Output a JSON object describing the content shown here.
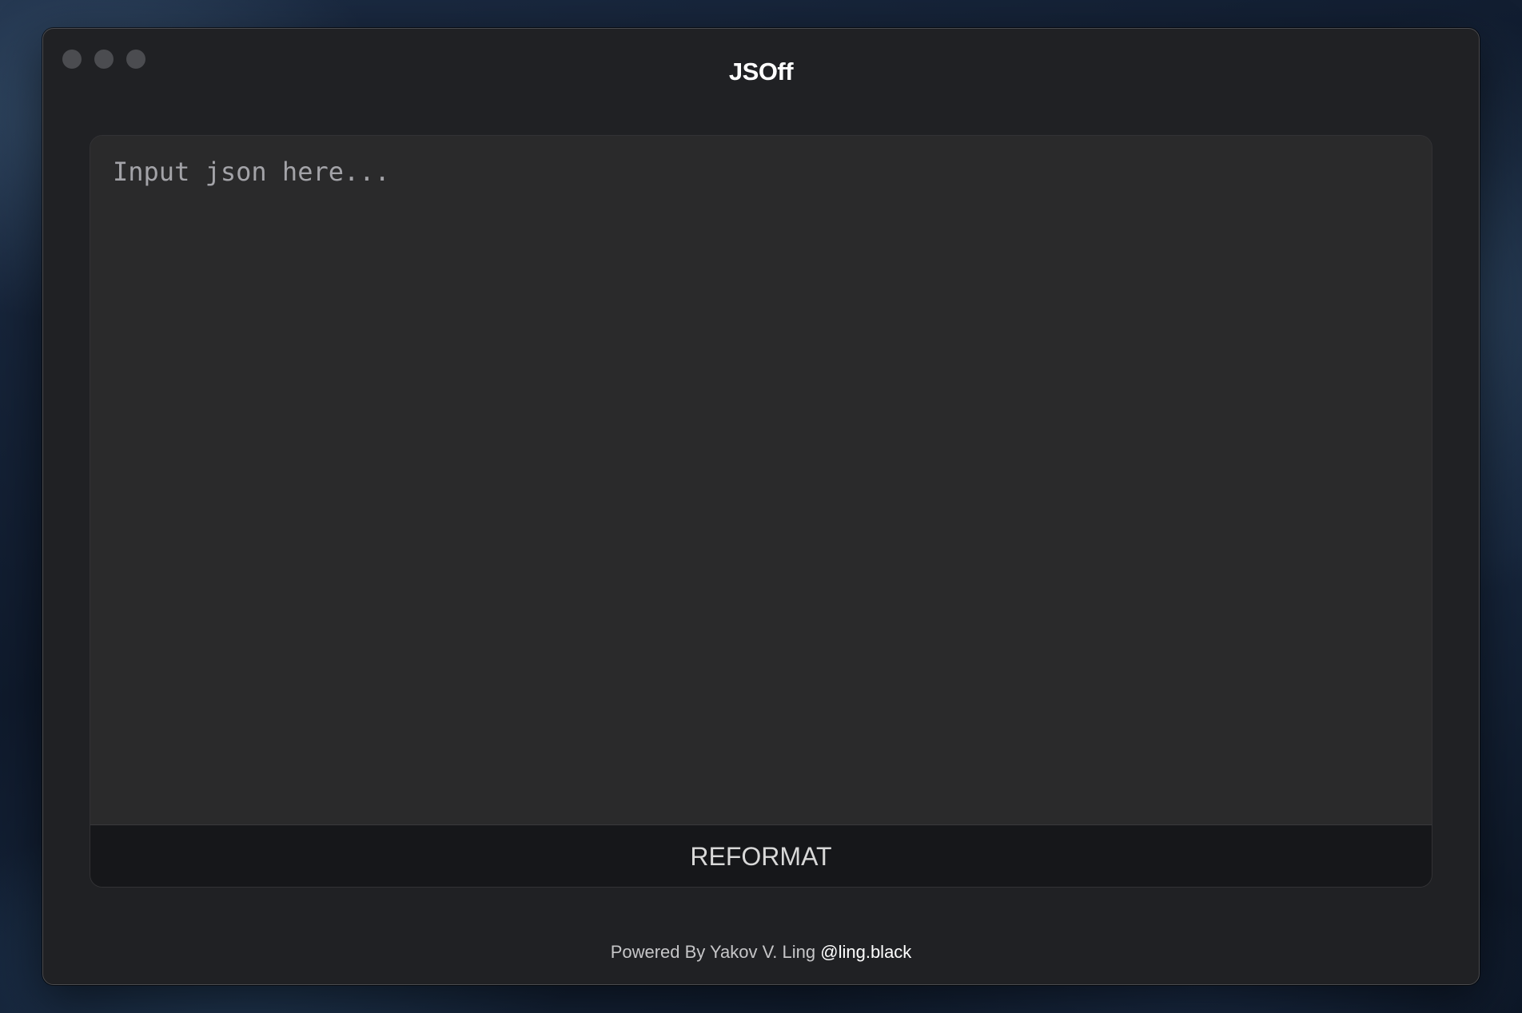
{
  "window": {
    "title": "JSOff"
  },
  "editor": {
    "value": "",
    "placeholder": "Input json here..."
  },
  "actions": {
    "reformat_label": "REFORMAT"
  },
  "footer": {
    "text": "Powered By Yakov V. Ling",
    "link_text": "@ling.black"
  }
}
